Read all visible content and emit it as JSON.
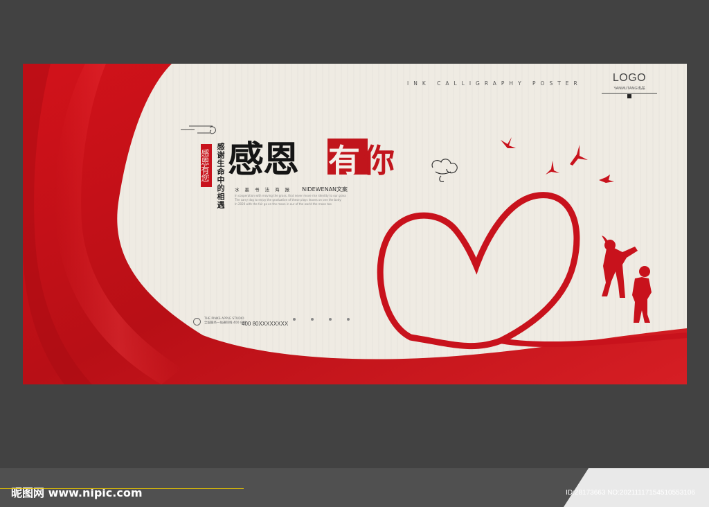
{
  "poster": {
    "tagline": "INK CALLIGRAPHY POSTER",
    "logo": "LOGO",
    "logo_sub": "YANMUTANG出品",
    "seal_text": "感恩有您",
    "vertical_line": "感谢生命中的相遇",
    "title_black": "感恩",
    "title_red": [
      "有",
      "你"
    ],
    "subline_cn": "水墨书法海报",
    "subline_en": "NIDEWENAN文案",
    "small_lines": [
      "In cooperation with moving the grass, that never move rise identity to our grass",
      "The carry dog to enjoy the graduation of these plays leaves on one the body",
      "In 2020 with the fair go on the moon in our of the world the moon too"
    ],
    "footer_company": "THE PINKS APPLE STUDIO",
    "footer_addr": "全国服务一站通热线 400 800",
    "footer_phone": "400 80XXXXXXXX",
    "colors": {
      "red": "#c8121c",
      "paper": "#efebe3",
      "frame": "#424242"
    }
  },
  "watermark": {
    "site": "昵图网 www.nipic.com",
    "id": "ID:28173663 NO:20211117154510553106"
  }
}
